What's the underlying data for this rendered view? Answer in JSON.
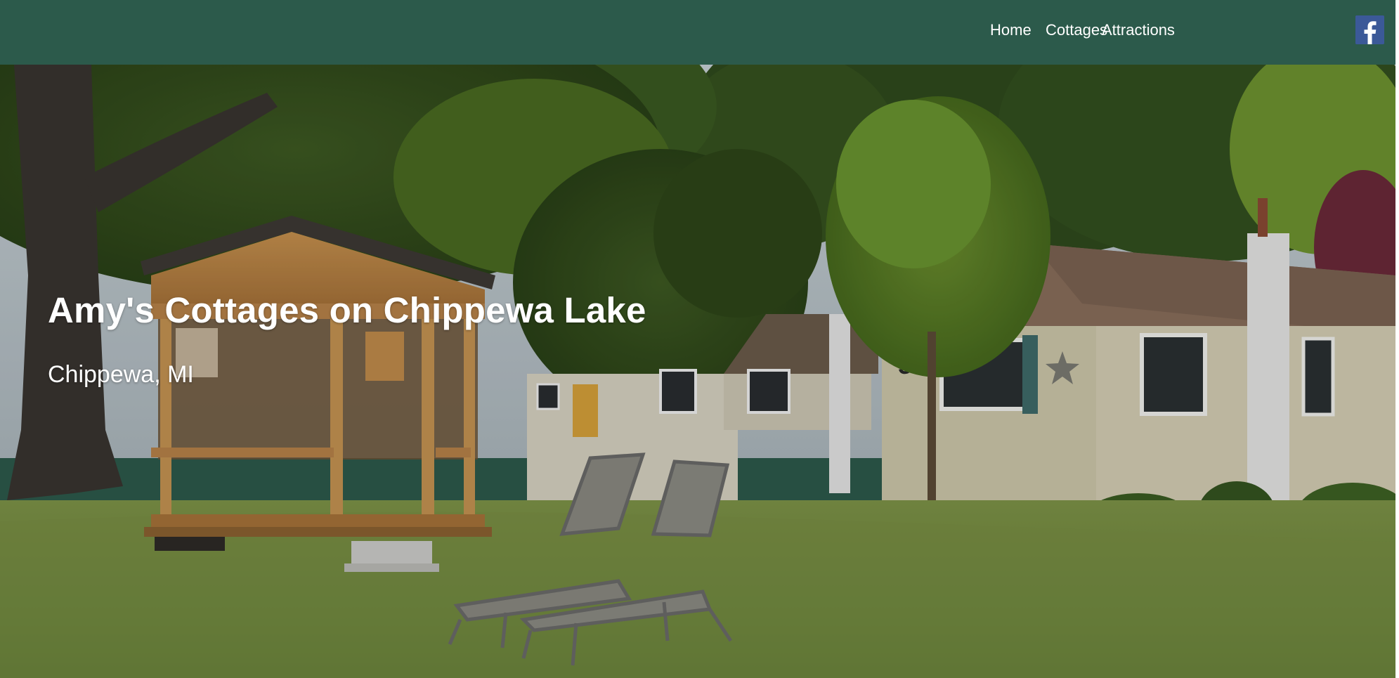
{
  "nav": {
    "items": [
      {
        "label": "Home"
      },
      {
        "label": "Cottages"
      },
      {
        "label": "Attractions"
      }
    ],
    "social_icon": "facebook-icon"
  },
  "hero": {
    "title": "Amy's Cottages on Chippewa Lake",
    "subtitle": "Chippewa, MI"
  },
  "colors": {
    "nav_background": "#2c5a4b",
    "nav_text": "#ffffff",
    "hero_text": "#ffffff",
    "facebook_blue": "#3b5998"
  }
}
